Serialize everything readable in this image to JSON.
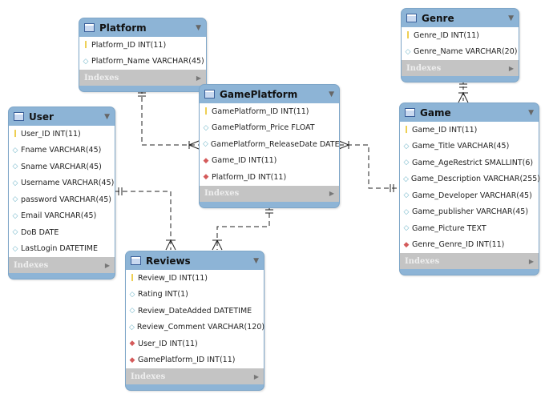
{
  "indexes_label": "Indexes",
  "colors": {
    "header": "#8db4d6",
    "indexes": "#c4c4c4",
    "pk": "#e8c020",
    "fk": "#d45a5a",
    "attr": "#6fb5c8"
  },
  "tables": [
    {
      "id": "platform",
      "name": "Platform",
      "columns": [
        {
          "text": "Platform_ID INT(11)",
          "key": "pk"
        },
        {
          "text": "Platform_Name VARCHAR(45)",
          "key": "attr"
        }
      ]
    },
    {
      "id": "genre",
      "name": "Genre",
      "columns": [
        {
          "text": "Genre_ID INT(11)",
          "key": "pk"
        },
        {
          "text": "Genre_Name VARCHAR(20)",
          "key": "attr"
        }
      ]
    },
    {
      "id": "gameplatform",
      "name": "GamePlatform",
      "columns": [
        {
          "text": "GamePlatform_ID INT(11)",
          "key": "pk"
        },
        {
          "text": "GamePlatform_Price FLOAT",
          "key": "attr"
        },
        {
          "text": "GamePlatform_ReleaseDate DATE",
          "key": "attr"
        },
        {
          "text": "Game_ID INT(11)",
          "key": "fk"
        },
        {
          "text": "Platform_ID INT(11)",
          "key": "fk"
        }
      ]
    },
    {
      "id": "user",
      "name": "User",
      "columns": [
        {
          "text": "User_ID INT(11)",
          "key": "pk"
        },
        {
          "text": "Fname VARCHAR(45)",
          "key": "attr"
        },
        {
          "text": "Sname VARCHAR(45)",
          "key": "attr"
        },
        {
          "text": "Username VARCHAR(45)",
          "key": "attr"
        },
        {
          "text": "password VARCHAR(45)",
          "key": "attr"
        },
        {
          "text": "Email VARCHAR(45)",
          "key": "attr"
        },
        {
          "text": "DoB DATE",
          "key": "attr"
        },
        {
          "text": "LastLogin DATETIME",
          "key": "attr"
        }
      ]
    },
    {
      "id": "game",
      "name": "Game",
      "columns": [
        {
          "text": "Game_ID INT(11)",
          "key": "pk"
        },
        {
          "text": "Game_Title VARCHAR(45)",
          "key": "attr"
        },
        {
          "text": "Game_AgeRestrict SMALLINT(6)",
          "key": "attr"
        },
        {
          "text": "Game_Description VARCHAR(255)",
          "key": "attr"
        },
        {
          "text": "Game_Developer VARCHAR(45)",
          "key": "attr"
        },
        {
          "text": "Game_publisher VARCHAR(45)",
          "key": "attr"
        },
        {
          "text": "Game_Picture TEXT",
          "key": "attr"
        },
        {
          "text": "Genre_Genre_ID INT(11)",
          "key": "fk"
        }
      ]
    },
    {
      "id": "reviews",
      "name": "Reviews",
      "columns": [
        {
          "text": "Review_ID INT(11)",
          "key": "pk"
        },
        {
          "text": "Rating INT(1)",
          "key": "attr"
        },
        {
          "text": "Review_DateAdded DATETIME",
          "key": "attr"
        },
        {
          "text": "Review_Comment VARCHAR(120)",
          "key": "attr"
        },
        {
          "text": "User_ID INT(11)",
          "key": "fk"
        },
        {
          "text": "GamePlatform_ID INT(11)",
          "key": "fk"
        }
      ]
    }
  ],
  "relationships": [
    {
      "from": "Platform",
      "to": "GamePlatform",
      "cardinality": "one-to-many"
    },
    {
      "from": "Game",
      "to": "GamePlatform",
      "cardinality": "one-to-many"
    },
    {
      "from": "Genre",
      "to": "Game",
      "cardinality": "one-to-many"
    },
    {
      "from": "User",
      "to": "Reviews",
      "cardinality": "one-to-many"
    },
    {
      "from": "GamePlatform",
      "to": "Reviews",
      "cardinality": "one-to-many"
    }
  ]
}
